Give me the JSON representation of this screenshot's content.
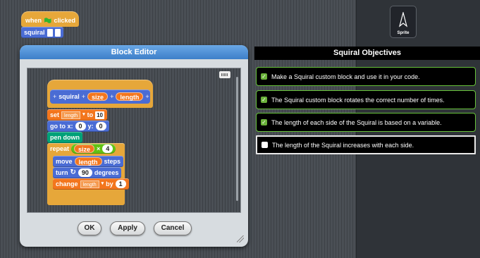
{
  "script": {
    "hat_when": "when",
    "hat_clicked": "clicked",
    "call_label": "squiral"
  },
  "sprite": {
    "label": "Sprite"
  },
  "dialog": {
    "title": "Block Editor",
    "prototype": {
      "name": "squiral",
      "param1": "size",
      "param2": "length"
    },
    "blocks": {
      "set_label": "set",
      "set_var": "length",
      "set_to": "to",
      "set_value": "10",
      "goto_label": "go to x:",
      "goto_x": "0",
      "goto_y_label": "y:",
      "goto_y": "0",
      "pendown": "pen down",
      "repeat_label": "repeat",
      "repeat_var": "size",
      "repeat_op": "×",
      "repeat_num": "4",
      "move_label": "move",
      "move_var": "length",
      "move_unit": "steps",
      "turn_label": "turn",
      "turn_value": "90",
      "turn_unit": "degrees",
      "change_label": "change",
      "change_var": "length",
      "change_by": "by",
      "change_value": "1"
    },
    "buttons": {
      "ok": "OK",
      "apply": "Apply",
      "cancel": "Cancel"
    }
  },
  "objectives": {
    "title": "Squiral Objectives",
    "items": [
      {
        "text": "Make a Squiral custom block and use it in your code.",
        "done": true
      },
      {
        "text": "The Squiral custom block rotates the correct number of times.",
        "done": true
      },
      {
        "text": "The length of each side of the Squiral is based on a variable.",
        "done": true
      },
      {
        "text": "The length of the Squiral increases with each side.",
        "done": false
      }
    ]
  },
  "colors": {
    "control": "#e6a73a",
    "motion": "#4a6cd4",
    "pen": "#00a178",
    "variables": "#f3761d",
    "operators": "#62c213",
    "complete": "#67c23a"
  }
}
